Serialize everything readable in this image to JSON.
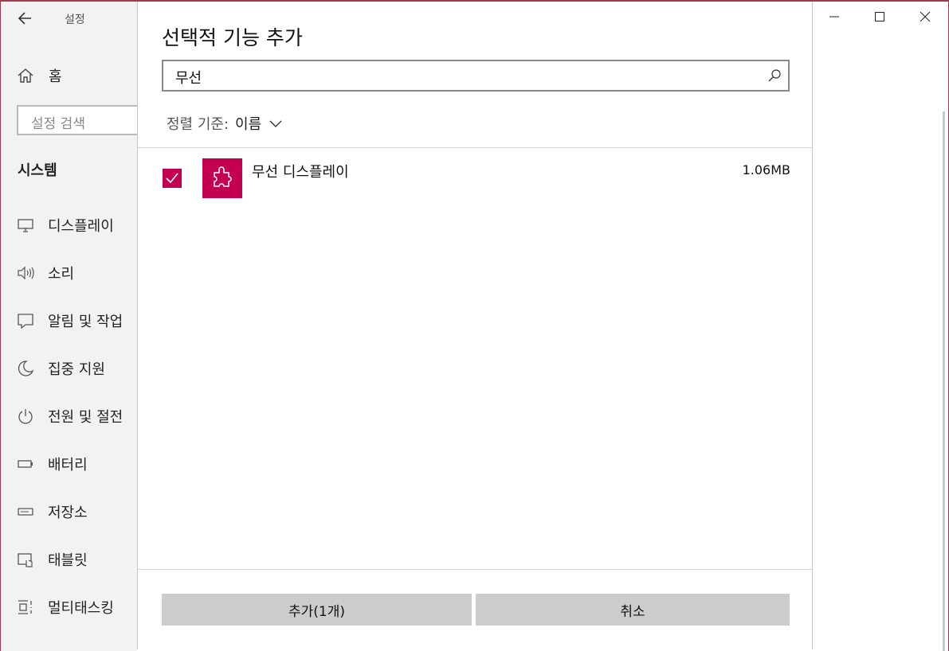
{
  "window": {
    "app_title": "설정",
    "controls": {
      "minimize": "minimize",
      "maximize": "maximize",
      "close": "close"
    }
  },
  "sidebar": {
    "home_label": "홈",
    "search_placeholder": "설정 검색",
    "section_title": "시스템",
    "items": [
      {
        "label": "디스플레이",
        "icon": "monitor-icon"
      },
      {
        "label": "소리",
        "icon": "speaker-icon"
      },
      {
        "label": "알림 및 작업",
        "icon": "notification-icon"
      },
      {
        "label": "집중 지원",
        "icon": "moon-icon"
      },
      {
        "label": "전원 및 절전",
        "icon": "power-icon"
      },
      {
        "label": "배터리",
        "icon": "battery-icon"
      },
      {
        "label": "저장소",
        "icon": "storage-icon"
      },
      {
        "label": "태블릿",
        "icon": "tablet-icon"
      },
      {
        "label": "멀티태스킹",
        "icon": "multitasking-icon"
      }
    ]
  },
  "dialog": {
    "title": "선택적 기능 추가",
    "search_value": "무선",
    "sort_label": "정렬 기준:",
    "sort_value": "이름",
    "features": [
      {
        "name": "무선 디스플레이",
        "size": "1.06MB",
        "checked": true,
        "icon": "puzzle-icon"
      }
    ],
    "add_button": "추가(1개)",
    "cancel_button": "취소"
  },
  "colors": {
    "accent": "#c30052",
    "sidebar_bg": "#f2f2f2",
    "button_bg": "#cccccc"
  }
}
